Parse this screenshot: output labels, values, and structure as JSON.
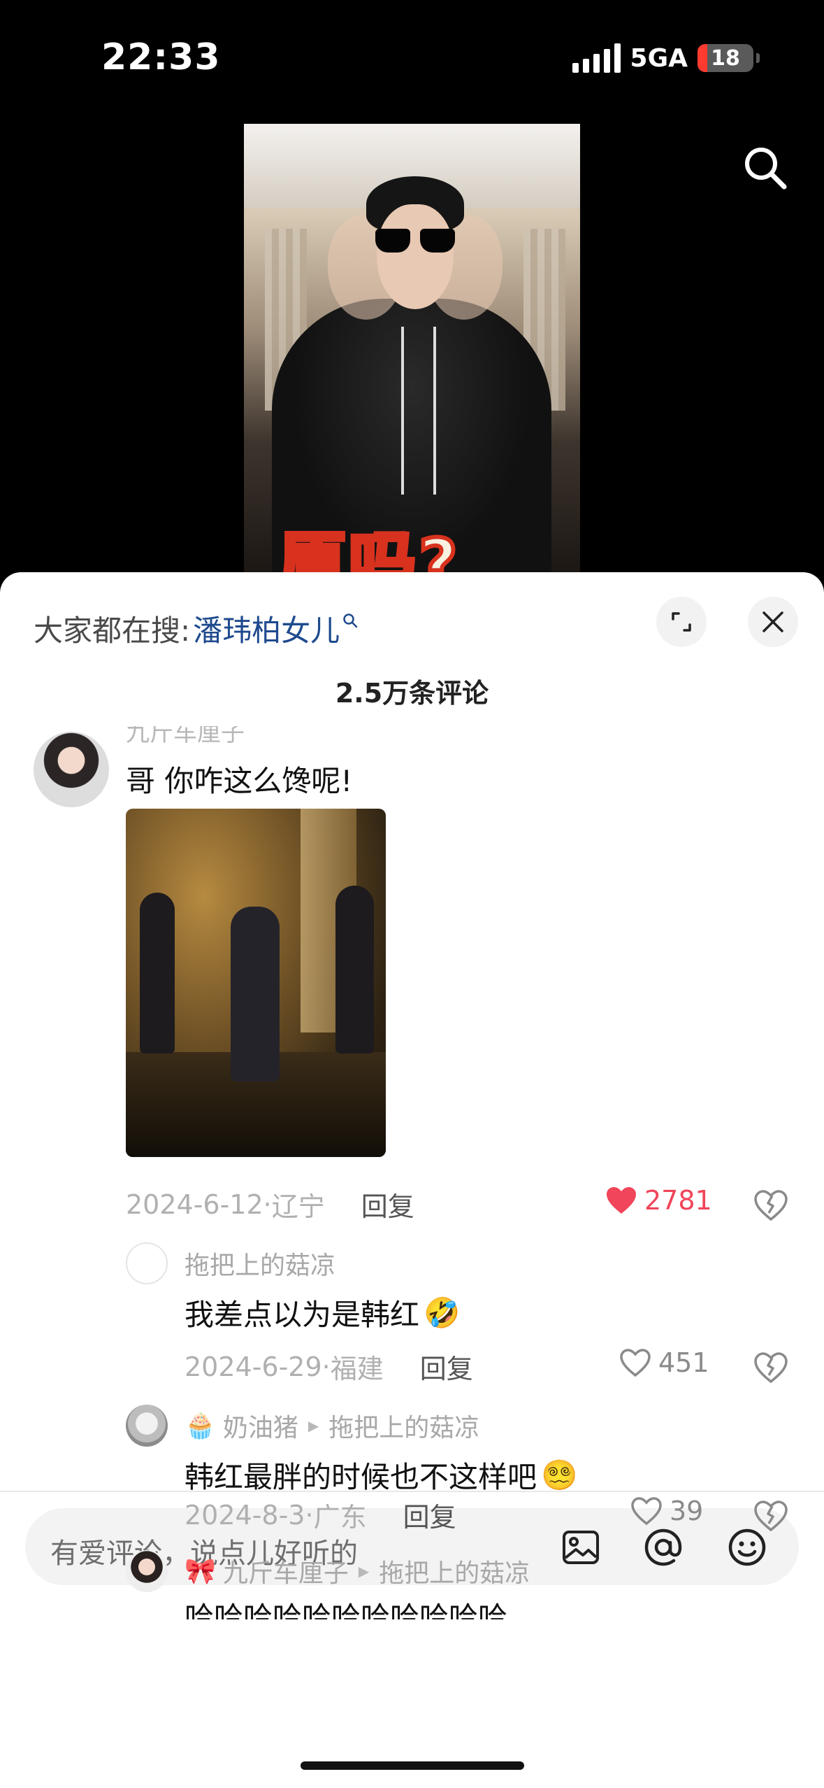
{
  "status_bar": {
    "time": "22:33",
    "network": "5GA",
    "battery": "18",
    "battery_level_percent": 18
  },
  "video": {
    "caption": "原吗?"
  },
  "sheet": {
    "hot_search_label": "大家都在搜:",
    "hot_search_keyword": "潘玮柏女儿",
    "comment_count": "2.5万条评论"
  },
  "comments": {
    "top": {
      "user_name": "九斤车厘子",
      "text": "哥 你咋这么馋呢!",
      "date": "2024-6-12",
      "location": "辽宁",
      "reply_label": "回复",
      "likes": "2781",
      "liked": true
    },
    "replies": [
      {
        "user_name": "拖把上的菇凉",
        "text": "我差点以为是韩红",
        "text_emoji": "🤣",
        "date": "2024-6-29",
        "location": "福建",
        "reply_label": "回复",
        "likes": "451"
      },
      {
        "user_emoji": "🧁",
        "user_name": "奶油猪",
        "reply_to": "拖把上的菇凉",
        "text": "韩红最胖的时候也不这样吧",
        "text_emoji": "😵‍💫",
        "date": "2024-8-3",
        "location": "广东",
        "reply_label": "回复",
        "likes": "39"
      },
      {
        "user_emoji": "🎀",
        "user_name": "九斤车厘子",
        "reply_to": "拖把上的菇凉",
        "text": "哈哈哈哈哈哈哈哈哈哈哈"
      }
    ]
  },
  "input": {
    "placeholder": "有爱评论，说点儿好听的"
  }
}
